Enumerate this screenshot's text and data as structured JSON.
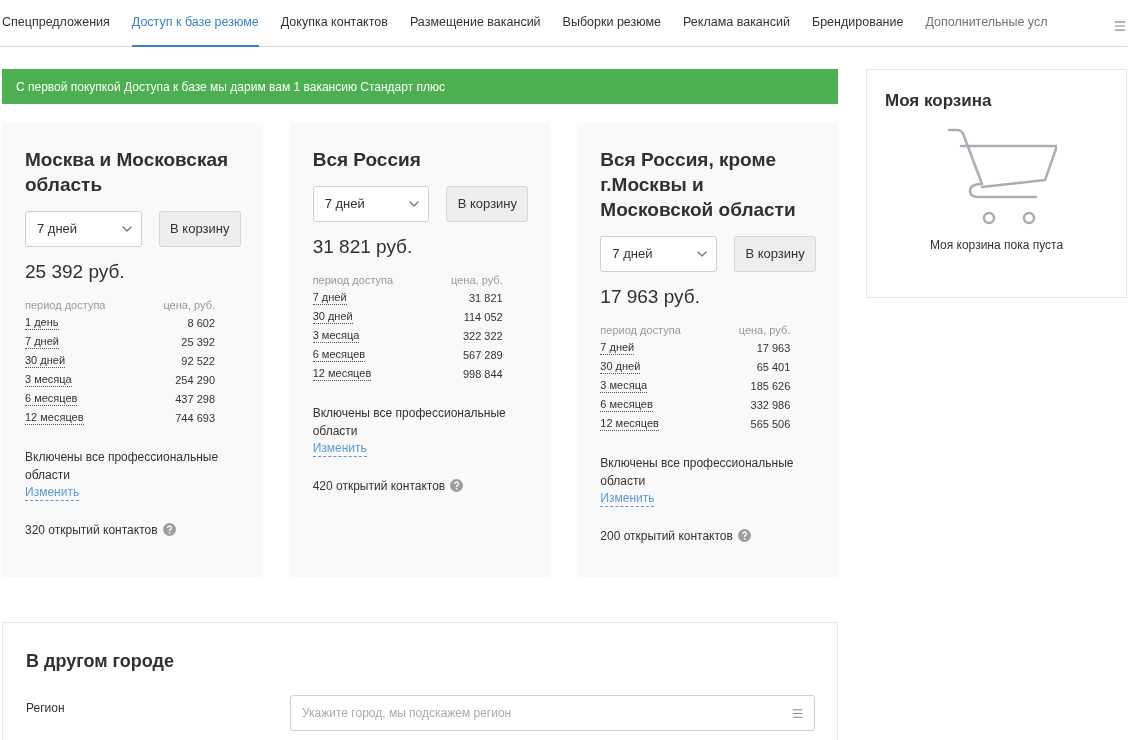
{
  "tabs": [
    {
      "label": "Спецпредложения",
      "selected": false
    },
    {
      "label": "Доступ к базе резюме",
      "selected": true
    },
    {
      "label": "Докупка контактов",
      "selected": false
    },
    {
      "label": "Размещение вакансий",
      "selected": false
    },
    {
      "label": "Выборки резюме",
      "selected": false
    },
    {
      "label": "Реклама вакансий",
      "selected": false
    },
    {
      "label": "Брендирование",
      "selected": false
    },
    {
      "label": "Дополнительные усл",
      "selected": false
    }
  ],
  "banner": "С первой покупкой Доступа к базе мы дарим вам 1 вакансию Стандарт плюс",
  "offers": [
    {
      "title": "Москва и Московская область",
      "period": "7 дней",
      "button": "В корзину",
      "price": "25 392 руб.",
      "headers": [
        "период доступа",
        "цена, руб."
      ],
      "rows": [
        {
          "period": "1 день",
          "price": "8 602"
        },
        {
          "period": "7 дней",
          "price": "25 392"
        },
        {
          "period": "30 дней",
          "price": "92 522"
        },
        {
          "period": "3 месяца",
          "price": "254 290"
        },
        {
          "period": "6 месяцев",
          "price": "437 298"
        },
        {
          "period": "12 месяцев",
          "price": "744 693"
        }
      ],
      "note": "Включены все профессиональные области",
      "link": "Изменить",
      "contacts": "320 открытий контактов"
    },
    {
      "title": "Вся Россия",
      "period": "7 дней",
      "button": "В корзину",
      "price": "31 821 руб.",
      "headers": [
        "период доступа",
        "цена, руб."
      ],
      "rows": [
        {
          "period": "7 дней",
          "price": "31 821"
        },
        {
          "period": "30 дней",
          "price": "114 052"
        },
        {
          "period": "3 месяца",
          "price": "322 322"
        },
        {
          "period": "6 месяцев",
          "price": "567 289"
        },
        {
          "period": "12 месяцев",
          "price": "998 844"
        }
      ],
      "note": "Включены все профессиональные области",
      "link": "Изменить",
      "contacts": "420 открытий контактов"
    },
    {
      "title": "Вся Россия, кроме г.Москвы и Московской области",
      "period": "7 дней",
      "button": "В корзину",
      "price": "17 963 руб.",
      "headers": [
        "период доступа",
        "цена, руб."
      ],
      "rows": [
        {
          "period": "7 дней",
          "price": "17 963"
        },
        {
          "period": "30 дней",
          "price": "65 401"
        },
        {
          "period": "3 месяца",
          "price": "185 626"
        },
        {
          "period": "6 месяцев",
          "price": "332 986"
        },
        {
          "period": "12 месяцев",
          "price": "565 506"
        }
      ],
      "note": "Включены все профессиональные области",
      "link": "Изменить",
      "contacts": "200 открытий контактов"
    }
  ],
  "cart": {
    "title": "Моя корзина",
    "empty": "Моя корзина пока пуста"
  },
  "other_city": {
    "title": "В другом городе",
    "label": "Регион",
    "placeholder": "Укажите город, мы подскажем регион"
  }
}
